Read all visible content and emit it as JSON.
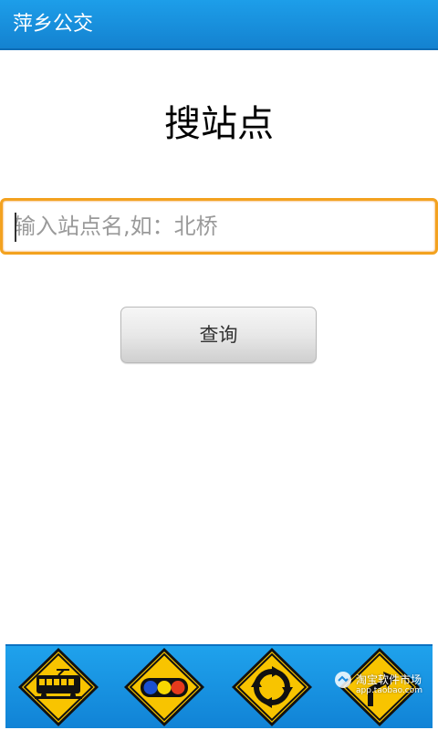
{
  "app": {
    "title": "萍乡公交"
  },
  "main": {
    "heading": "搜站点",
    "search": {
      "placeholder": "输入站点名,如：北桥",
      "value": ""
    },
    "query_button_label": "查询"
  },
  "bottom_nav": {
    "items": [
      {
        "icon": "tram-icon"
      },
      {
        "icon": "traffic-light-icon"
      },
      {
        "icon": "roundabout-icon"
      },
      {
        "icon": "direction-sign-icon"
      }
    ]
  },
  "watermark": {
    "line1": "淘宝软件市场",
    "line2": "app.taobao.com"
  },
  "colors": {
    "title_bar": "#1d9ee9",
    "accent_focus": "#f3a21f",
    "sign_yellow": "#f8c400"
  }
}
